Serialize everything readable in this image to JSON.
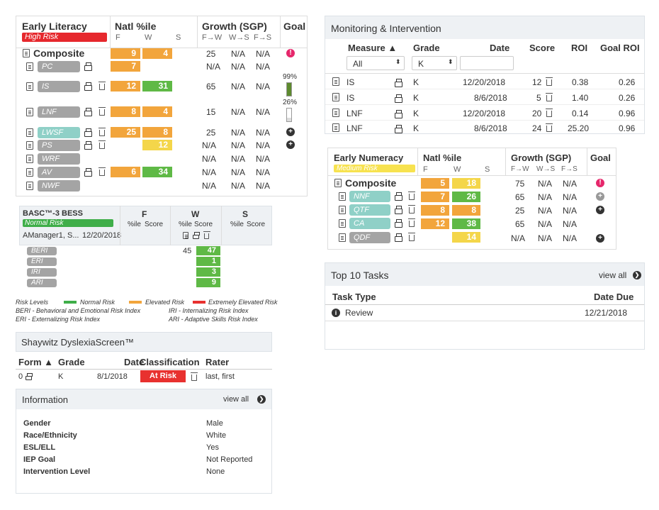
{
  "literacy": {
    "title": "Early Literacy",
    "risk": "High Risk",
    "natl_header": "Natl %ile",
    "growth_header": "Growth (SGP)",
    "goal_header": "Goal",
    "cols": [
      "F",
      "W",
      "S",
      "F→W",
      "W→S",
      "F→S"
    ],
    "composite_label": "Composite",
    "rows": [
      {
        "label": "PC",
        "f": "7",
        "w": "",
        "g1": "N/A",
        "g2": "N/A",
        "g3": "N/A"
      },
      {
        "label": "IS",
        "f": "12",
        "w": "31",
        "g1": "65",
        "g2": "N/A",
        "g3": "N/A"
      },
      {
        "label": "LNF",
        "f": "8",
        "w": "4",
        "g1": "15",
        "g2": "N/A",
        "g3": "N/A"
      },
      {
        "label": "LWSF",
        "f": "25",
        "w": "8",
        "g1": "25",
        "g2": "N/A",
        "g3": "N/A"
      },
      {
        "label": "PS",
        "f": "",
        "w": "12",
        "g1": "N/A",
        "g2": "N/A",
        "g3": "N/A"
      },
      {
        "label": "WRF",
        "f": "",
        "w": "",
        "g1": "N/A",
        "g2": "N/A",
        "g3": "N/A"
      },
      {
        "label": "AV",
        "f": "6",
        "w": "34",
        "g1": "N/A",
        "g2": "N/A",
        "g3": "N/A"
      },
      {
        "label": "NWF",
        "f": "",
        "w": "",
        "g1": "N/A",
        "g2": "N/A",
        "g3": "N/A"
      }
    ],
    "composite": {
      "f": "9",
      "w": "4",
      "g1": "25",
      "g2": "N/A",
      "g3": "N/A"
    },
    "goal_pct_top": "99%",
    "goal_pct_bottom": "26%"
  },
  "basc": {
    "title": "BASC™-3 BESS",
    "risk": "Normal Risk",
    "rater": "AManager1, S...",
    "date": "12/20/2018",
    "F": "F",
    "W": "W",
    "S": "S",
    "sub": "%ile",
    "sub2": "Score",
    "rows": [
      {
        "label": "BERI",
        "pct": "45",
        "score": "47"
      },
      {
        "label": "ERI",
        "pct": "",
        "score": "1"
      },
      {
        "label": "IRI",
        "pct": "",
        "score": "3"
      },
      {
        "label": "ARI",
        "pct": "",
        "score": "9"
      }
    ],
    "legend_title": "Risk Levels",
    "normal": "Normal Risk",
    "elevated": "Elevated Risk",
    "extreme": "Extremely Elevated Risk",
    "def1": "BERI - Behavioral and Emotional Risk Index",
    "def2": "IRI - Internalizing Risk Index",
    "def3": "ERI - Externalizing Risk Index",
    "def4": "ARI - Adaptive Skills Risk Index"
  },
  "dyslexia": {
    "title": "Shaywitz DyslexiaScreen™",
    "headers": [
      "Form ▲",
      "Grade",
      "Date",
      "Classification",
      "Rater"
    ],
    "form": "0",
    "grade": "K",
    "date": "8/1/2018",
    "classification": "At Risk",
    "rater": "last, first"
  },
  "info": {
    "title": "Information",
    "view_all": "view all",
    "rows": [
      {
        "k": "Gender",
        "v": "Male"
      },
      {
        "k": "Race/Ethnicity",
        "v": "White"
      },
      {
        "k": "ESL/ELL",
        "v": "Yes"
      },
      {
        "k": "IEP Goal",
        "v": "Not Reported"
      },
      {
        "k": "Intervention Level",
        "v": "None"
      }
    ]
  },
  "monitoring": {
    "title": "Monitoring & Intervention",
    "headers": [
      "Measure ▲",
      "Grade",
      "Date",
      "Score",
      "ROI",
      "Goal ROI"
    ],
    "filter_measure": "All",
    "filter_grade": "K",
    "rows": [
      {
        "m": "IS",
        "g": "K",
        "d": "12/20/2018",
        "s": "12",
        "roi": "0.38",
        "groi": "0.26"
      },
      {
        "m": "IS",
        "g": "K",
        "d": "8/6/2018",
        "s": "5",
        "roi": "1.40",
        "groi": "0.26"
      },
      {
        "m": "LNF",
        "g": "K",
        "d": "12/20/2018",
        "s": "20",
        "roi": "0.14",
        "groi": "0.96"
      },
      {
        "m": "LNF",
        "g": "K",
        "d": "8/6/2018",
        "s": "24",
        "roi": "25.20",
        "groi": "0.96"
      }
    ]
  },
  "numeracy": {
    "title": "Early Numeracy",
    "risk": "Medium Risk",
    "natl_header": "Natl %ile",
    "growth_header": "Growth (SGP)",
    "goal_header": "Goal",
    "cols": [
      "F",
      "W",
      "S",
      "F→W",
      "W→S",
      "F→S"
    ],
    "composite_label": "Composite",
    "composite": {
      "f": "5",
      "w": "18",
      "g1": "75",
      "g2": "N/A",
      "g3": "N/A"
    },
    "rows": [
      {
        "label": "NNF",
        "f": "7",
        "w": "26",
        "g1": "65",
        "g2": "N/A",
        "g3": "N/A"
      },
      {
        "label": "QTF",
        "f": "8",
        "w": "8",
        "g1": "25",
        "g2": "N/A",
        "g3": "N/A"
      },
      {
        "label": "CA",
        "f": "12",
        "w": "38",
        "g1": "65",
        "g2": "N/A",
        "g3": "N/A"
      },
      {
        "label": "QDF",
        "f": "",
        "w": "14",
        "g1": "N/A",
        "g2": "N/A",
        "g3": "N/A"
      }
    ]
  },
  "tasks": {
    "title": "Top 10 Tasks",
    "view_all": "view all",
    "type_header": "Task Type",
    "due_header": "Date Due",
    "row_type": "Review",
    "row_due": "12/21/2018"
  }
}
